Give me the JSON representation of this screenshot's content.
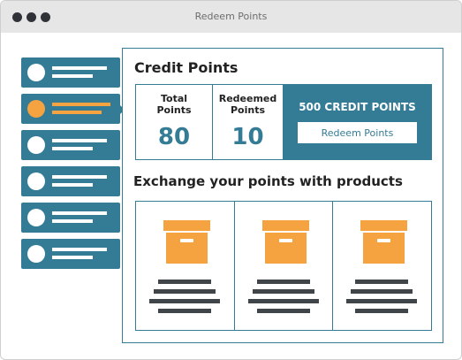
{
  "window": {
    "title": "Redeem Points"
  },
  "panel": {
    "title": "Credit Points",
    "stats": {
      "total_label_1": "Total",
      "total_label_2": "Points",
      "total_value": "80",
      "redeemed_label_1": "Redeemed",
      "redeemed_label_2": "Points",
      "redeemed_value": "10"
    },
    "credit": {
      "text": "500 CREDIT POINTS",
      "button_label": "Redeem Points"
    },
    "section_title": "Exchange your points with products"
  },
  "colors": {
    "primary": "#347b95",
    "accent": "#f4a340",
    "dark": "#3f4549"
  },
  "sidebar": {
    "item_count": 6,
    "active_index": 1
  },
  "icons": {
    "product": "box-icon",
    "avatar": "avatar-circle"
  }
}
